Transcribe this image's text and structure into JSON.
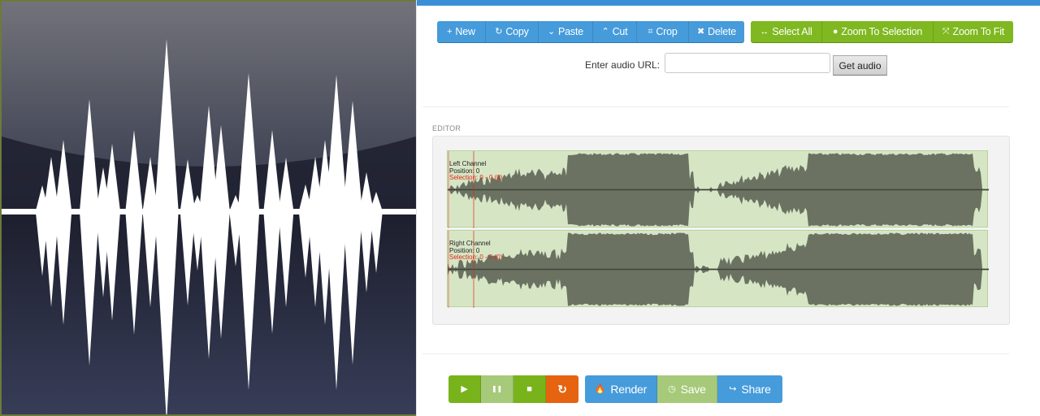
{
  "app_icon": {
    "name": "audio-waveform-app-icon",
    "colors": {
      "top": "#72737a",
      "bottom": "#363a55",
      "wave": "#ffffff"
    }
  },
  "toolbar": {
    "edit_buttons": [
      {
        "icon": "plus-icon",
        "glyph": "+",
        "label": "New"
      },
      {
        "icon": "copy-icon",
        "glyph": "↻",
        "label": "Copy"
      },
      {
        "icon": "chevron-down-icon",
        "glyph": "⌄",
        "label": "Paste"
      },
      {
        "icon": "chevron-up-icon",
        "glyph": "⌃",
        "label": "Cut"
      },
      {
        "icon": "crop-icon",
        "glyph": "⌗",
        "label": "Crop"
      },
      {
        "icon": "close-icon",
        "glyph": "✖",
        "label": "Delete"
      }
    ],
    "view_buttons": [
      {
        "icon": "arrows-horizontal-icon",
        "glyph": "↔",
        "label": "Select All"
      },
      {
        "icon": "circle-icon",
        "glyph": "●",
        "label": "Zoom To Selection"
      },
      {
        "icon": "expand-icon",
        "glyph": "⤧",
        "label": "Zoom To Fit"
      }
    ]
  },
  "url_form": {
    "label": "Enter audio URL:",
    "value": "",
    "placeholder": "",
    "submit_label": "Get audio"
  },
  "editor": {
    "section_label": "EDITOR",
    "channels": [
      {
        "name": "Left Channel",
        "position": "Position: 0",
        "selection": "Selection: 0 - 0 (0)"
      },
      {
        "name": "Right Channel",
        "position": "Position: 0",
        "selection": "Selection: 0 - 0 (0)"
      }
    ],
    "colors": {
      "background": "#d6e6c5",
      "waveform": "#6b7262",
      "cursor": "#e2281b"
    }
  },
  "transport": {
    "buttons": [
      {
        "icon": "play-icon",
        "glyph": "▶",
        "label": ""
      },
      {
        "icon": "pause-icon",
        "glyph": "❚❚",
        "label": ""
      },
      {
        "icon": "stop-icon",
        "glyph": "■",
        "label": ""
      },
      {
        "icon": "reload-icon",
        "glyph": "↻",
        "label": ""
      }
    ]
  },
  "output": {
    "buttons": [
      {
        "icon": "fire-icon",
        "glyph": "🔥",
        "label": "Render"
      },
      {
        "icon": "clock-icon",
        "glyph": "◷",
        "label": "Save"
      },
      {
        "icon": "share-icon",
        "glyph": "↪",
        "label": "Share"
      }
    ]
  }
}
